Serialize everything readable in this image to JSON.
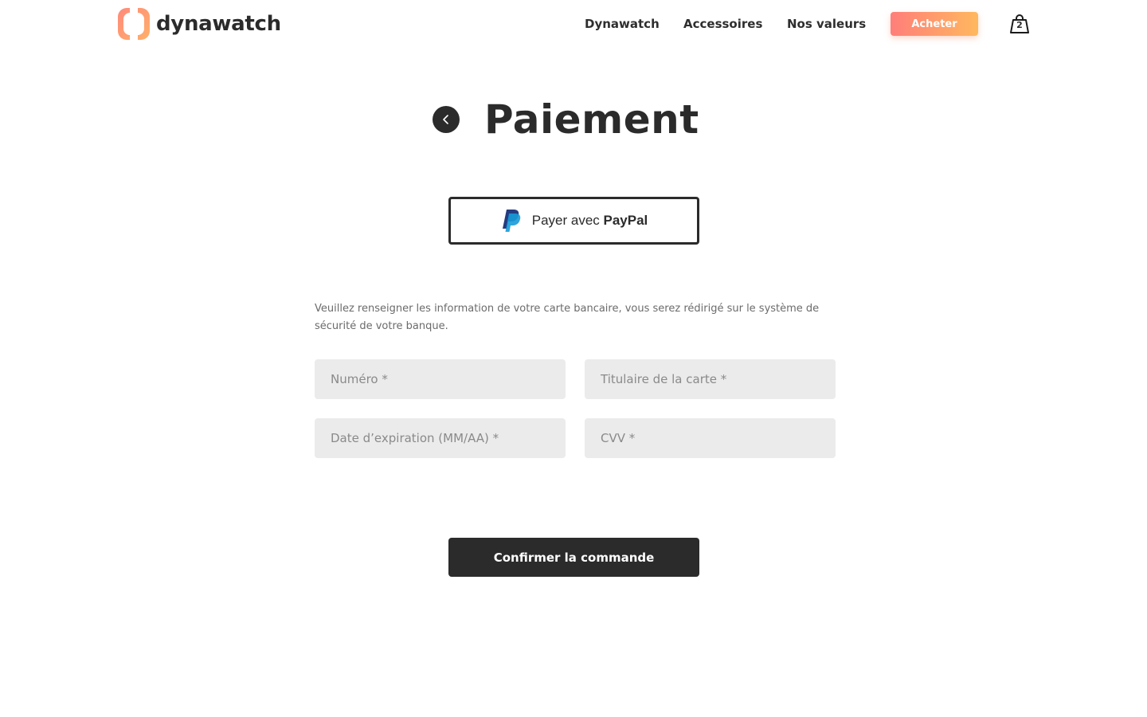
{
  "header": {
    "logo_text": "dynawatch",
    "nav": {
      "dynawatch": "Dynawatch",
      "accessoires": "Accessoires",
      "valeurs": "Nos valeurs"
    },
    "buy_label": "Acheter",
    "cart_count": "2"
  },
  "main": {
    "title": "Paiement",
    "paypal": {
      "prefix": "Payer avec ",
      "brand": "PayPal"
    },
    "intro": "Veuillez renseigner les information de votre carte bancaire, vous serez rédirigé sur le système de sécurité de votre banque.",
    "fields": {
      "numero": "Numéro *",
      "titulaire": "Titulaire de la carte *",
      "date": "Date d’expiration (MM/AA) *",
      "cvv": "CVV *"
    },
    "confirm_label": "Confirmer la commande"
  },
  "icons": {
    "logo": "watch-logo-icon",
    "cart": "shopping-bag-icon",
    "back": "chevron-left-icon",
    "paypal": "paypal-icon"
  },
  "colors": {
    "accent_start": "#ff7e7a",
    "accent_end": "#ffb85e",
    "dark": "#2b2b2b",
    "field_bg": "#ebebeb",
    "paypal_dark": "#253b80",
    "paypal_light": "#179bd7"
  }
}
